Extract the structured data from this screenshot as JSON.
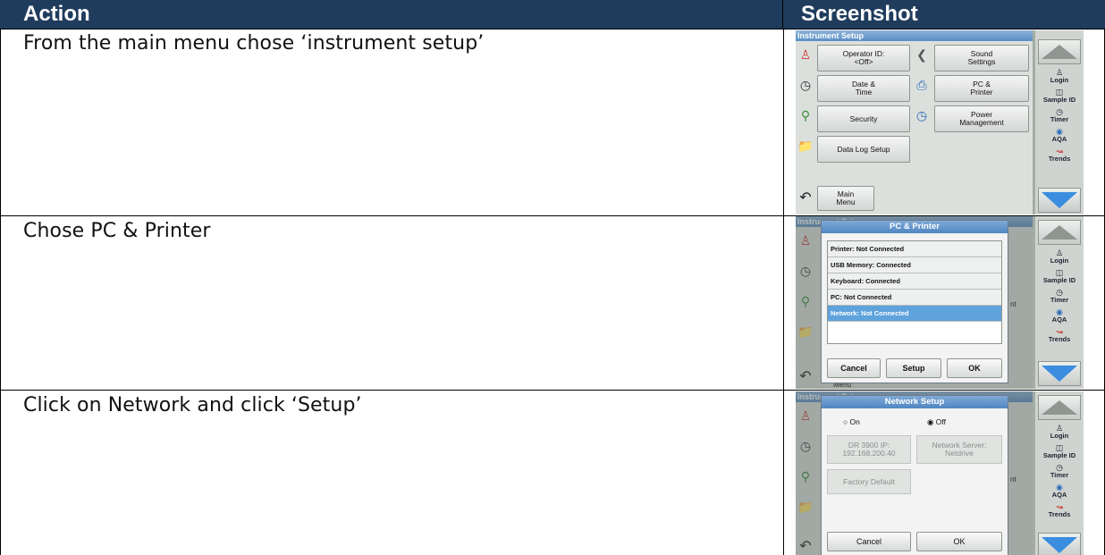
{
  "table": {
    "header_action": "Action",
    "header_screenshot": "Screenshot",
    "rows": [
      {
        "action": "From the main menu chose ‘instrument setup’"
      },
      {
        "action": "Chose PC & Printer"
      },
      {
        "action": "Click on Network and click ‘Setup’"
      }
    ]
  },
  "instrument": {
    "title": "Instrument Setup",
    "menu": {
      "operator": "Operator ID:",
      "operator_value": "<Off>",
      "sound": "Sound",
      "sound2": "Settings",
      "date": "Date &",
      "date2": "Time",
      "pc": "PC &",
      "pc2": "Printer",
      "security": "Security",
      "power": "Power",
      "power2": "Management",
      "datalog": "Data Log Setup",
      "main": "Main",
      "main2": "Menu"
    },
    "sidebar": {
      "login": "Login",
      "sample_id": "Sample ID",
      "timer": "Timer",
      "aqa": "AQA",
      "trends": "Trends"
    }
  },
  "pc_printer": {
    "title": "PC & Printer",
    "items": [
      "Printer: Not Connected",
      "USB Memory: Connected",
      "Keyboard: Connected",
      "PC: Not Connected",
      "Network: Not Connected"
    ],
    "cancel": "Cancel",
    "setup": "Setup",
    "ok": "OK",
    "bg_title": "Instrument Setup",
    "bg_nt": "nt",
    "bg_menu": "Menu"
  },
  "network": {
    "title": "Network Setup",
    "on": "On",
    "off": "Off",
    "ip_label": "DR 3900 IP:",
    "ip_value": "192.168.200.40",
    "server_label": "Network Server:",
    "server_value": "Netdrive",
    "factory": "Factory Default",
    "cancel": "Cancel",
    "ok": "OK"
  }
}
